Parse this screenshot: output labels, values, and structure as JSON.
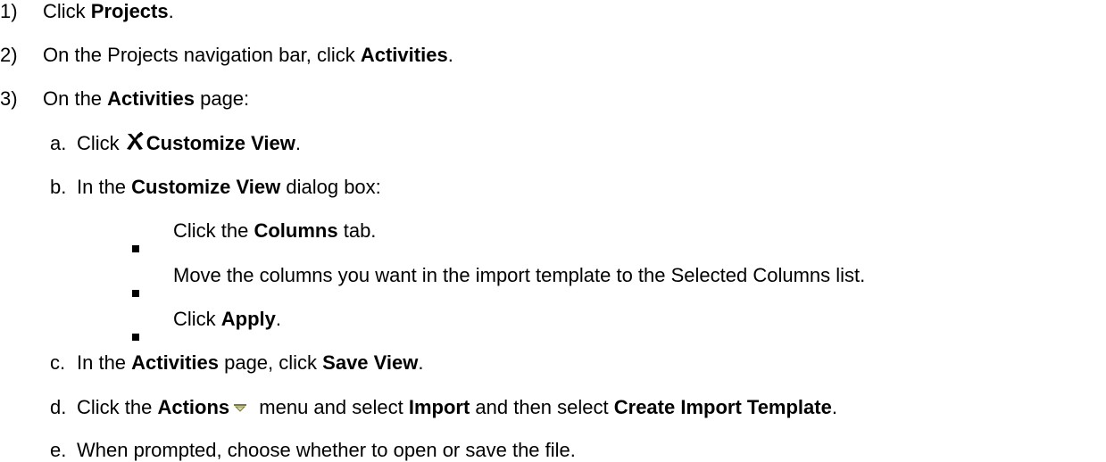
{
  "steps": {
    "s1": {
      "num": "1)",
      "pre": "Click ",
      "bold": "Projects",
      "post": "."
    },
    "s2": {
      "num": "2)",
      "pre": "On the Projects navigation bar, click ",
      "bold": "Activities",
      "post": "."
    },
    "s3": {
      "num": "3)",
      "pre": "On the ",
      "bold": "Activities",
      "post": " page:"
    }
  },
  "substeps": {
    "a": {
      "letter": "a.",
      "pre": "Click ",
      "icon": "customize-tools-icon",
      "bold": "Customize View",
      "post": "."
    },
    "b": {
      "letter": "b.",
      "pre": "In the ",
      "bold": "Customize View",
      "post": " dialog box:"
    },
    "c": {
      "letter": "c.",
      "pre": "In the ",
      "bold": "Activities",
      "mid": " page, click ",
      "bold2": "Save View",
      "post": "."
    },
    "d": {
      "letter": "d.",
      "pre": "Click the ",
      "bold": "Actions",
      "icon": "dropdown-arrow-icon",
      "mid": " menu and select ",
      "bold2": "Import",
      "mid2": " and then select ",
      "bold3": "Create Import Template",
      "post": "."
    },
    "e": {
      "letter": "e.",
      "text": "When prompted, choose whether to open or save the file."
    }
  },
  "bullets": {
    "b1": {
      "pre": "Click the ",
      "bold": "Columns",
      "post": " tab."
    },
    "b2": {
      "text": "Move the columns you want in the import template to the Selected Columns list."
    },
    "b3": {
      "pre": "Click ",
      "bold": "Apply",
      "post": "."
    }
  },
  "colors": {
    "text": "#000000",
    "dropdown_fill": "#d9d9a8",
    "dropdown_stroke": "#7a7a40"
  }
}
